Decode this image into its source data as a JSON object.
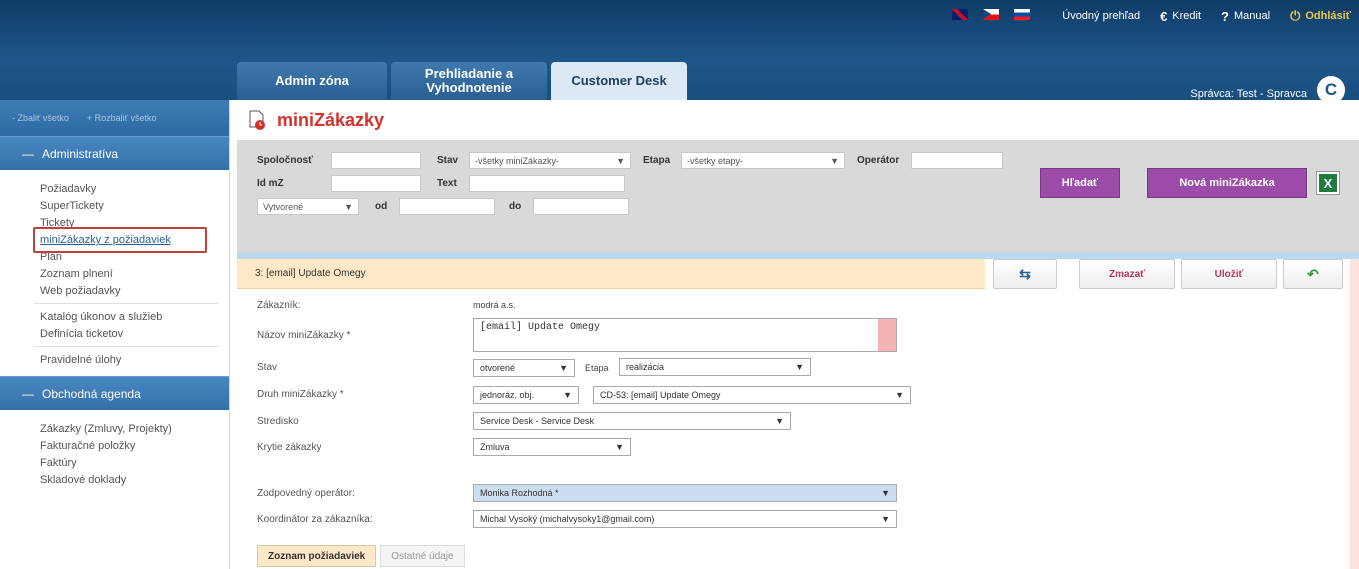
{
  "header": {
    "links": {
      "overview": "Úvodný prehľad",
      "credit": "Kredit",
      "manual": "Manual",
      "logout": "Odhlásiť"
    },
    "tabs": [
      {
        "label": "Admin zóna"
      },
      {
        "label": "Prehliadanie a Vyhodnotenie"
      },
      {
        "label": "Customer Desk"
      }
    ],
    "user": "Správca: Test - Spravca",
    "logo": "C"
  },
  "sidebar": {
    "collapse_all": "- Zbaliť všetko",
    "expand_all": "+ Rozbaliť všetko",
    "sections": [
      {
        "title": "Administratíva",
        "items": [
          "Požiadavky",
          "SuperTickety",
          "Tickety",
          "miniZákazky z požiadaviek",
          "Plán",
          "Zoznam plnení",
          "Web požiadavky",
          "Katalóg úkonov a služieb",
          "Definícia ticketov",
          "Pravidelné úlohy"
        ]
      },
      {
        "title": "Obchodná agenda",
        "items": [
          "Zákazky (Zmluvy, Projekty)",
          "Fakturačné položky",
          "Faktúry",
          "Skladové doklady"
        ]
      }
    ]
  },
  "page": {
    "title": "miniZákazky",
    "filters": {
      "company_label": "Spoločnosť",
      "status_label": "Stav",
      "status_value": "-všetky miniZákazky-",
      "stage_label": "Etapa",
      "stage_value": "-všetky etapy-",
      "operator_label": "Operátor",
      "id_label": "Id mZ",
      "text_label": "Text",
      "date_type": "Vytvorené",
      "from_label": "od",
      "to_label": "do"
    },
    "search_button": "Hľadať",
    "new_button": "Nová miniZákazka",
    "record_title": "3: [email] Update Omegy",
    "delete_button": "Zmazať",
    "save_button": "Uložiť"
  },
  "form": {
    "customer_label": "Zákazník:",
    "customer_value": "modrá a.s.",
    "name_label": "Názov miniZákazky *",
    "name_value": "[email] Update Omegy",
    "status_label": "Stav",
    "status_value": "otvorené",
    "stage_label": "Etapa",
    "stage_value": "realizácia",
    "type_label": "Druh miniZákazky *",
    "type_value": "jednoráz. obj.",
    "type_ref": "CD-53: [email] Update Omegy",
    "center_label": "Stredisko",
    "center_value": "Service Desk - Service Desk",
    "coverage_label": "Krytie zákazky",
    "coverage_value": "Zmluva",
    "operator_label": "Zodpovedný operátor:",
    "operator_value": "Monika Rozhodná *",
    "coordinator_label": "Koordinátor za zákazníka:",
    "coordinator_value": "Michal Vysoký (michalvysoky1@gmail.com)"
  },
  "bottom_tabs": [
    "Zoznam požiadaviek",
    "Ostatné údaje"
  ]
}
